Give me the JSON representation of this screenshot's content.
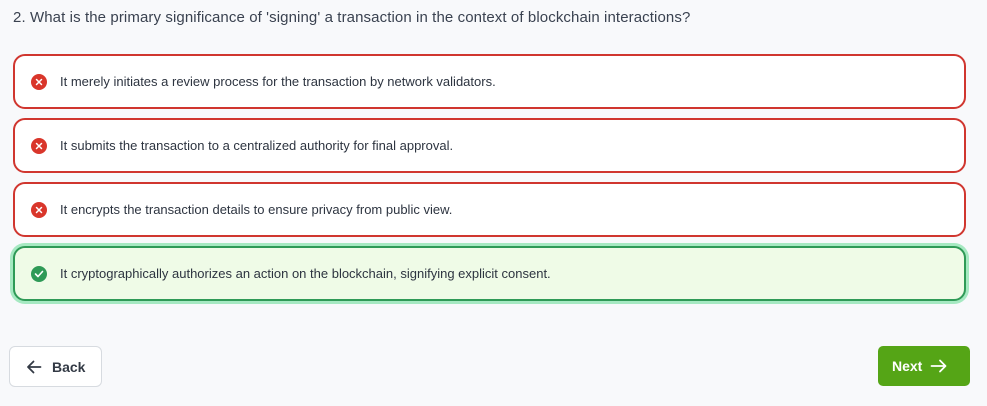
{
  "question": {
    "text": "2. What is the primary significance of 'signing' a transaction in the context of blockchain interactions?"
  },
  "options": [
    {
      "text": "It merely initiates a review process for the transaction by network validators.",
      "status": "incorrect",
      "icon": "x-circle-icon"
    },
    {
      "text": "It submits the transaction to a centralized authority for final approval.",
      "status": "incorrect",
      "icon": "x-circle-icon"
    },
    {
      "text": "It encrypts the transaction details to ensure privacy from public view.",
      "status": "incorrect",
      "icon": "x-circle-icon"
    },
    {
      "text": "It cryptographically authorizes an action on the blockchain, signifying explicit consent.",
      "status": "correct",
      "icon": "check-circle-icon"
    }
  ],
  "navigation": {
    "back_label": "Back",
    "next_label": "Next"
  },
  "colors": {
    "incorrect": "#d9362b",
    "correct": "#2f9a57",
    "correct_background": "#effbe7",
    "next_button": "#55a516"
  }
}
